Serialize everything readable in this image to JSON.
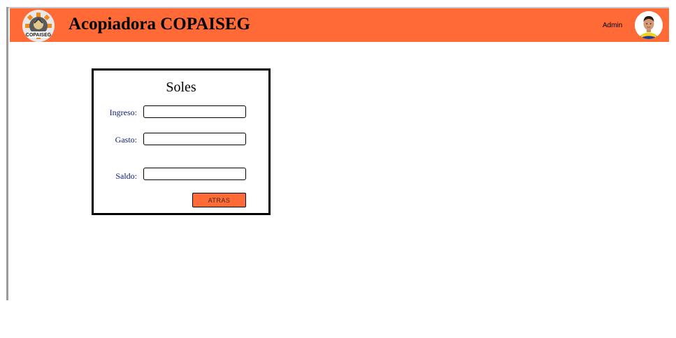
{
  "header": {
    "title": "Acopiadora COPAISEG",
    "logo_text": "COPAISEG",
    "user_name": "Admin",
    "accent_color": "#ff6a36"
  },
  "panel": {
    "title": "Soles",
    "fields": [
      {
        "label": "Ingreso:",
        "value": "",
        "placeholder": ""
      },
      {
        "label": "Gasto:",
        "value": "",
        "placeholder": ""
      },
      {
        "label": "Saldo:",
        "value": "",
        "placeholder": ""
      }
    ],
    "back_label": "ATRAS"
  },
  "icons": {
    "logo": "company-gear-logo",
    "avatar": "user-avatar-photo"
  }
}
